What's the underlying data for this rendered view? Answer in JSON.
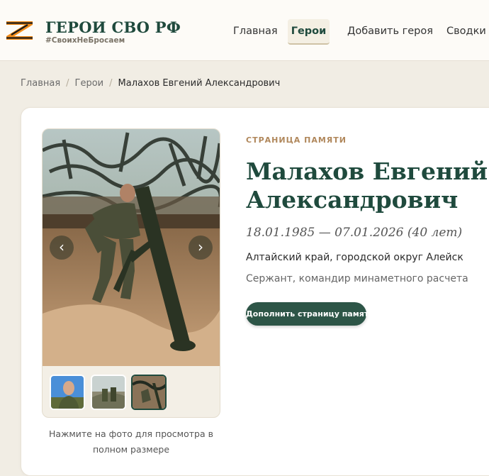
{
  "header": {
    "brand_title": "ГЕРОИ СВО РФ",
    "brand_tagline": "#СвоихНеБросаем",
    "nav": {
      "home": "Главная",
      "heroes": "Герои",
      "add_hero": "Добавить героя",
      "reports": "Сводки"
    }
  },
  "breadcrumb": {
    "home": "Главная",
    "heroes": "Герои",
    "current": "Малахов Евгений Александрович"
  },
  "gallery": {
    "prev": "‹",
    "next": "›",
    "caption": "Нажмите на фото для просмотра в полном размере"
  },
  "hero": {
    "label": "СТРАНИЦА ПАМЯТИ",
    "name": "Малахов Евгений Александрович",
    "dates": "18.01.1985 — 07.01.2026 (40 лет)",
    "place": "Алтайский край, городской округ Алейск",
    "rank": "Сержант, командир минаметного расчета",
    "cta": "Дополнить страницу памяти"
  },
  "colors": {
    "accent": "#1f4a3d",
    "button": "#2d5547",
    "label": "#b0875b",
    "background": "#f1ede4"
  }
}
